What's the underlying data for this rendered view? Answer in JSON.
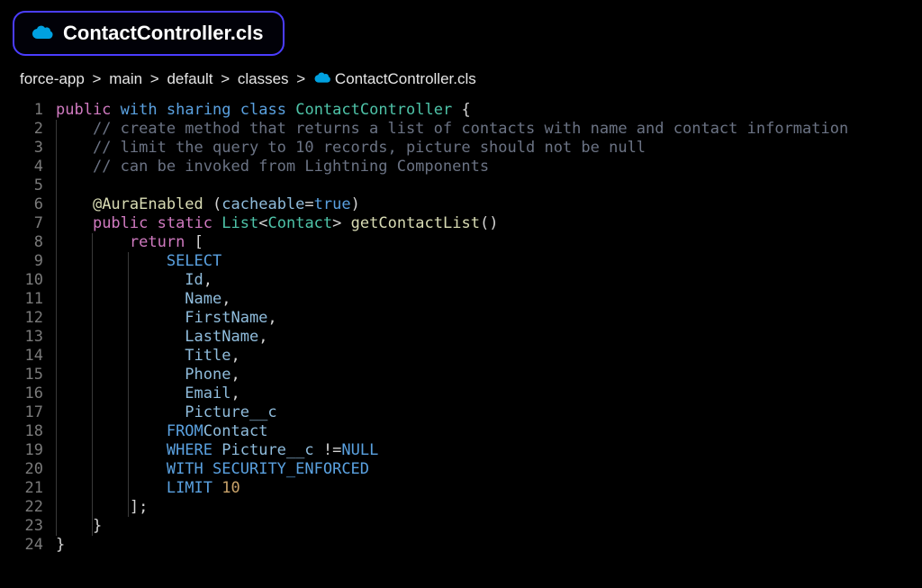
{
  "tab": {
    "label": "ContactController.cls"
  },
  "breadcrumb": {
    "segments": [
      "force-app",
      "main",
      "default",
      "classes"
    ],
    "sep": " > ",
    "file": "ContactController.cls"
  },
  "icon": {
    "cloud_color": "#00a1e0"
  },
  "editor": {
    "line_numbers": [
      "1",
      "2",
      "3",
      "4",
      "5",
      "6",
      "7",
      "8",
      "9",
      "10",
      "11",
      "12",
      "13",
      "14",
      "15",
      "16",
      "17",
      "18",
      "19",
      "20",
      "21",
      "22",
      "23",
      "24"
    ],
    "lines": {
      "l1": {
        "kw_public": "public",
        "mod_with": "with",
        "mod_sharing": "sharing",
        "mod_class": "class",
        "name": "ContactController",
        "brace": "{"
      },
      "l2": {
        "comment": "// create method that returns a list of contacts with name and contact information"
      },
      "l3": {
        "comment": "// limit the query to 10 records, picture should not be null"
      },
      "l4": {
        "comment": "// can be invoked from Lightning Components"
      },
      "l5": {
        "text": ""
      },
      "l6": {
        "anno": "@AuraEnabled",
        "paren_o": "(",
        "arg": "cacheable",
        "eq": "=",
        "val": "true",
        "paren_c": ")"
      },
      "l7": {
        "kw_public": "public",
        "kw_static": "static",
        "type_list": "List",
        "lt": "<",
        "type_contact": "Contact",
        "gt": ">",
        "fn": "getContactList",
        "parens": "()"
      },
      "l8": {
        "kw_return": "return",
        "bracket": "["
      },
      "l9": {
        "kw": "SELECT"
      },
      "l10": {
        "field": "Id",
        "comma": ","
      },
      "l11": {
        "field": "Name",
        "comma": ","
      },
      "l12": {
        "field": "FirstName",
        "comma": ","
      },
      "l13": {
        "field": "LastName",
        "comma": ","
      },
      "l14": {
        "field": "Title",
        "comma": ","
      },
      "l15": {
        "field": "Phone",
        "comma": ","
      },
      "l16": {
        "field": "Email",
        "comma": ","
      },
      "l17": {
        "field": "Picture__c"
      },
      "l18": {
        "kw": "FROM",
        "obj": "Contact"
      },
      "l19": {
        "kw": "WHERE",
        "field": "Picture__c",
        "op": "!=",
        "null": "NULL"
      },
      "l20": {
        "kw": "WITH",
        "sec": "SECURITY_ENFORCED"
      },
      "l21": {
        "kw": "LIMIT",
        "num": "10"
      },
      "l22": {
        "bracket": "];"
      },
      "l23": {
        "brace": "}"
      },
      "l24": {
        "brace": "}"
      }
    }
  }
}
